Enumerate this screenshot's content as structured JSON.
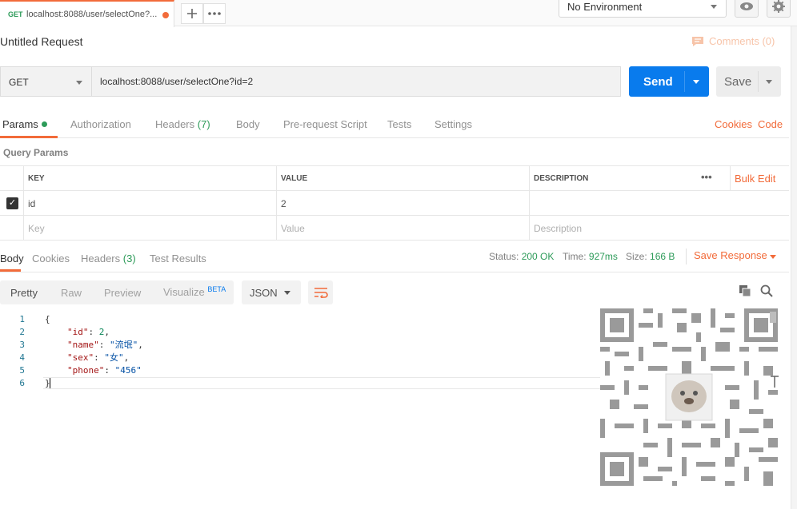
{
  "tab": {
    "method": "GET",
    "title": "localhost:8088/user/selectOne?..."
  },
  "environment": {
    "selected": "No Environment"
  },
  "request": {
    "title": "Untitled Request",
    "comments": "Comments (0)",
    "method": "GET",
    "url": "localhost:8088/user/selectOne?id=2",
    "send_label": "Send",
    "save_label": "Save"
  },
  "request_tabs": [
    {
      "label": "Params"
    },
    {
      "label": "Authorization"
    },
    {
      "label": "Headers",
      "count": "(7)"
    },
    {
      "label": "Body"
    },
    {
      "label": "Pre-request Script"
    },
    {
      "label": "Tests"
    },
    {
      "label": "Settings"
    }
  ],
  "links": {
    "cookies": "Cookies",
    "code": "Code"
  },
  "params": {
    "section_title": "Query Params",
    "headers": {
      "key": "KEY",
      "value": "VALUE",
      "description": "DESCRIPTION",
      "more": "•••",
      "bulk_edit": "Bulk Edit"
    },
    "rows": [
      {
        "checked": true,
        "key": "id",
        "value": "2",
        "description": ""
      }
    ],
    "placeholders": {
      "key": "Key",
      "value": "Value",
      "description": "Description"
    }
  },
  "response_tabs": [
    {
      "label": "Body"
    },
    {
      "label": "Cookies"
    },
    {
      "label": "Headers",
      "count": "(3)"
    },
    {
      "label": "Test Results"
    }
  ],
  "response_status": {
    "status_label": "Status:",
    "status_value": "200 OK",
    "time_label": "Time:",
    "time_value": "927ms",
    "size_label": "Size:",
    "size_value": "166 B",
    "save_response": "Save Response"
  },
  "view_modes": {
    "pretty": "Pretty",
    "raw": "Raw",
    "preview": "Preview",
    "visualize": "Visualize",
    "beta": "BETA",
    "format": "JSON"
  },
  "code_lines": [
    {
      "n": "1",
      "text": "{"
    },
    {
      "n": "2",
      "key": "\"id\"",
      "val": "2",
      "kind": "num",
      "comma": ","
    },
    {
      "n": "3",
      "key": "\"name\"",
      "val": "\"流氓\"",
      "kind": "str",
      "comma": ","
    },
    {
      "n": "4",
      "key": "\"sex\"",
      "val": "\"女\"",
      "kind": "str",
      "comma": ","
    },
    {
      "n": "5",
      "key": "\"phone\"",
      "val": "\"456\"",
      "kind": "str",
      "comma": ""
    },
    {
      "n": "6",
      "text": "}"
    }
  ],
  "colors": {
    "accent": "#f26b3a",
    "send": "#097bed",
    "success": "#2d9b59"
  }
}
